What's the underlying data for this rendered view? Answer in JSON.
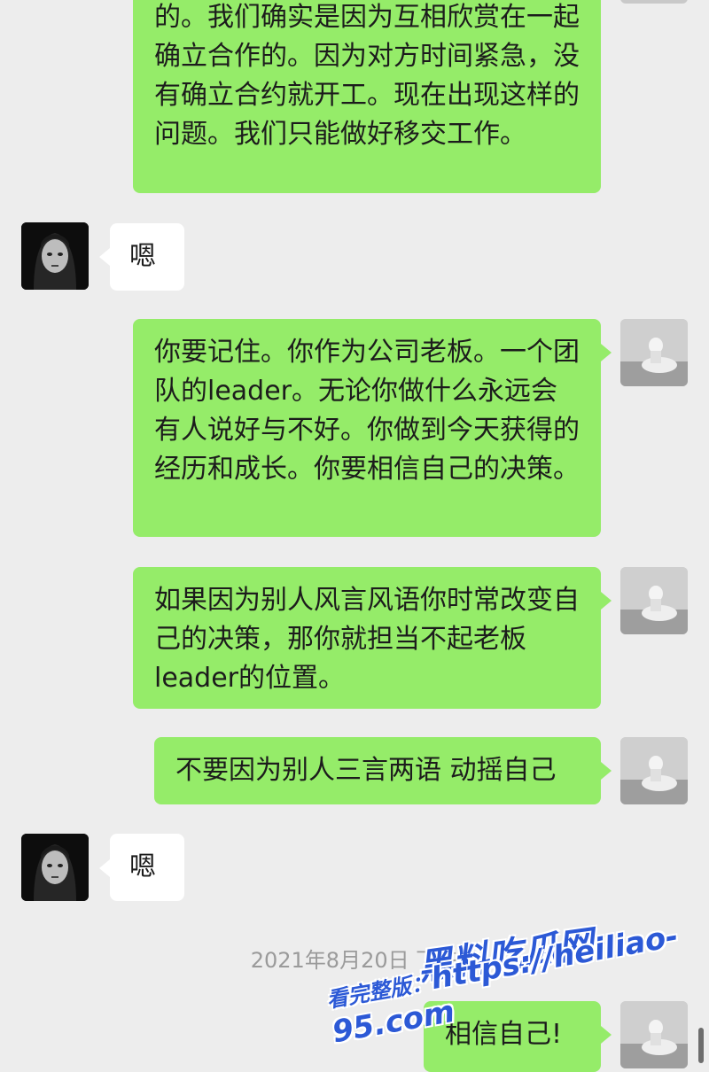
{
  "chat": {
    "messages": [
      {
        "from": "me",
        "text": "的。我们确实是因为互相欣赏在一起确立合作的。因为对方时间紧急，没有确立合约就开工。现在出现这样的问题。我们只能做好移交工作。"
      },
      {
        "from": "other",
        "text": "嗯"
      },
      {
        "from": "me",
        "text": "你要记住。你作为公司老板。一个团队的leader。无论你做什么永远会有人说好与不好。你做到今天获得的经历和成长。你要相信自己的决策。"
      },
      {
        "from": "me",
        "text": "如果因为别人风言风语你时常改变自己的决策，那你就担当不起老板leader的位置。"
      },
      {
        "from": "me",
        "text": "不要因为别人三言两语 动摇自己"
      },
      {
        "from": "other",
        "text": "嗯"
      },
      {
        "from": "me",
        "text": "相信自己!"
      }
    ],
    "timestamp": "2021年8月20日 下午"
  },
  "watermark": {
    "brand": "黑料吃瓜网",
    "prefix": "看完整版：",
    "url": "https://heiliao-95.com",
    "color": "#2c59d6"
  },
  "colors": {
    "background": "#ededed",
    "my_bubble": "#95ec69",
    "other_bubble": "#ffffff",
    "timestamp": "#9a9a9a"
  }
}
